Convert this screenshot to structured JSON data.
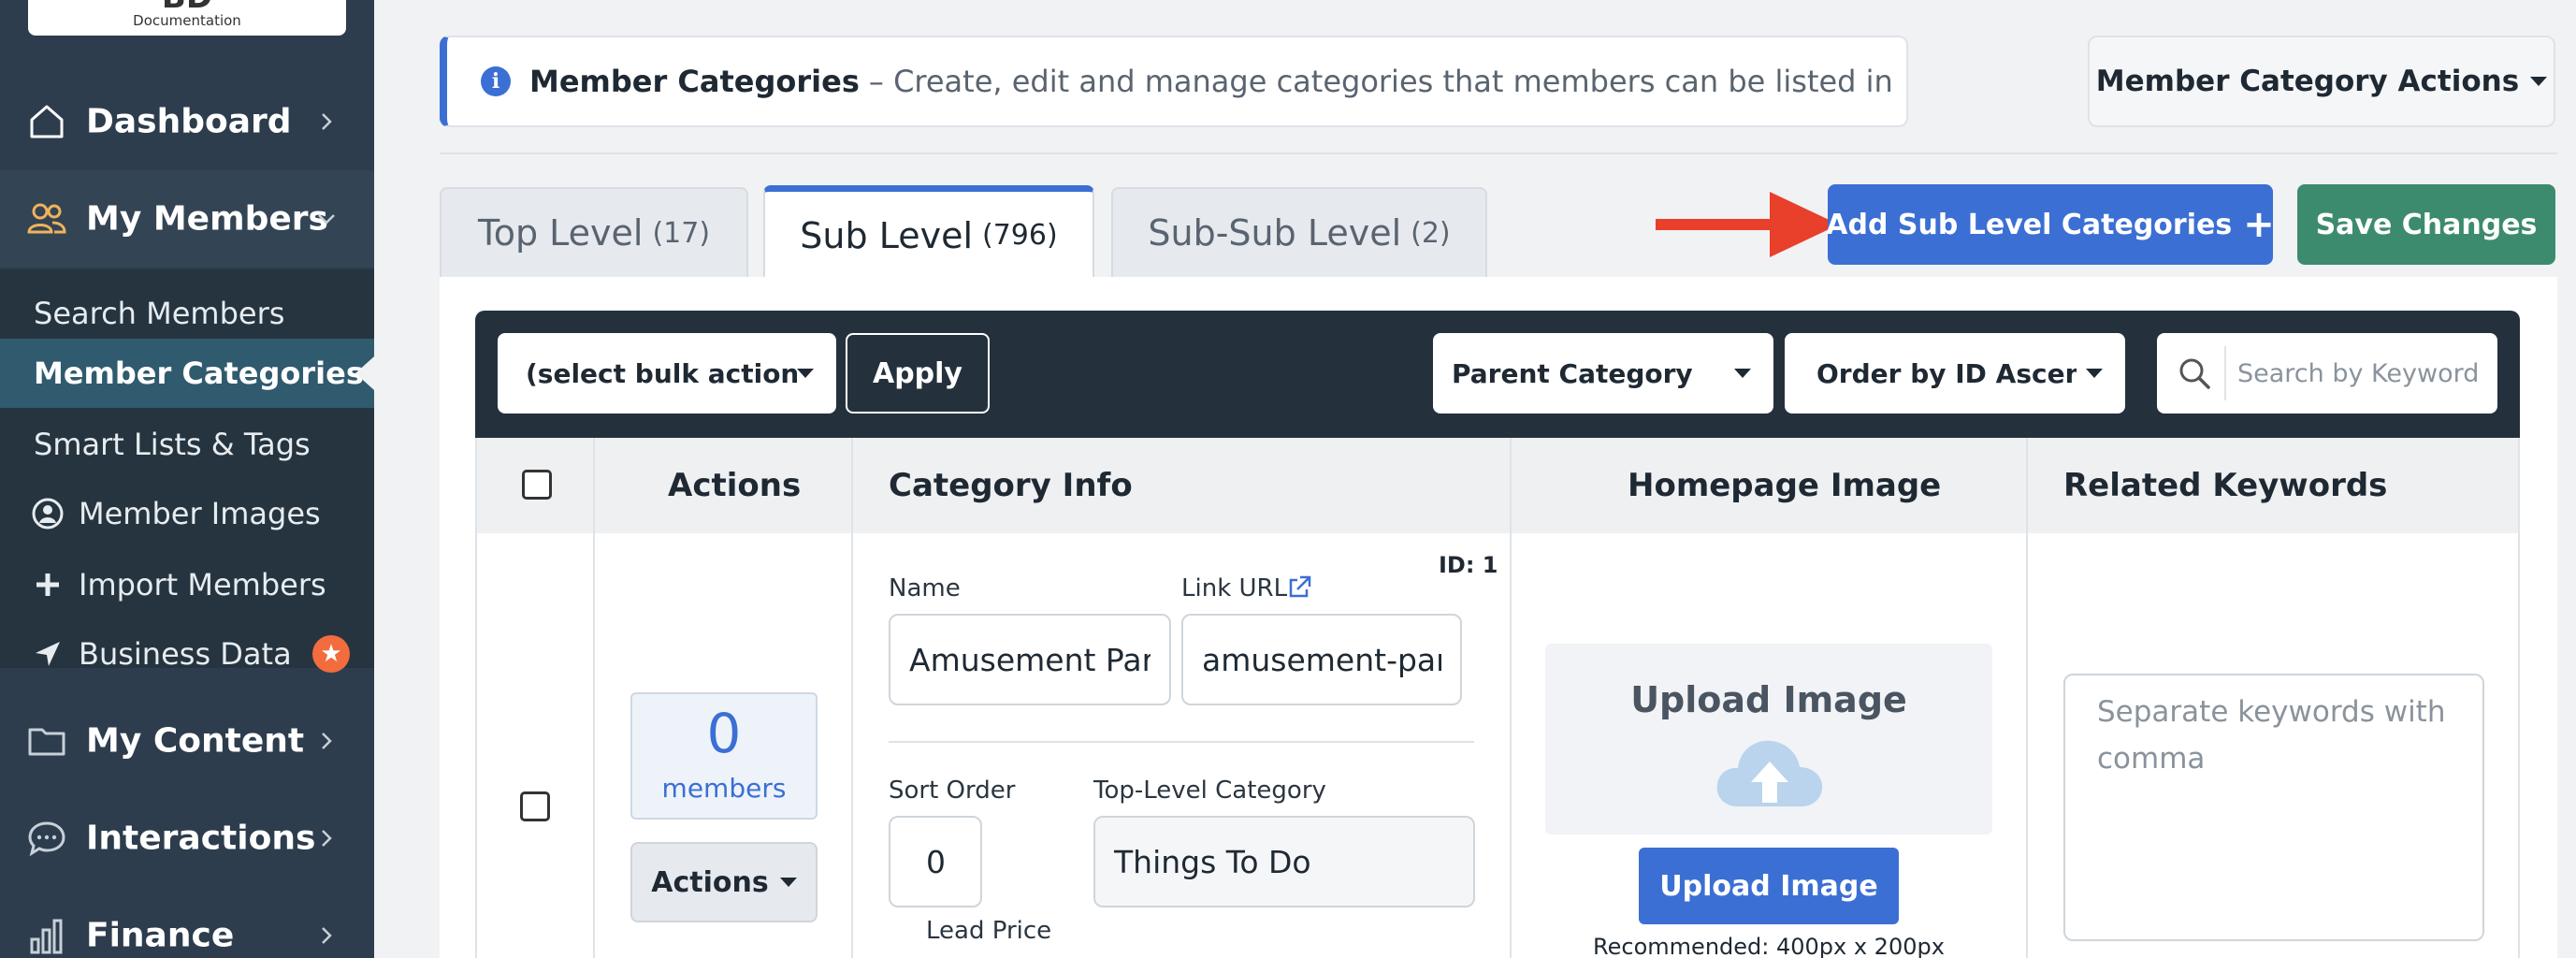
{
  "logo": {
    "mark": "BD",
    "sub": "Documentation"
  },
  "sidebar": {
    "nav": [
      {
        "label": "Dashboard",
        "icon": "home-icon"
      },
      {
        "label": "My Members",
        "icon": "users-icon"
      },
      {
        "label": "My Content",
        "icon": "folder-icon"
      },
      {
        "label": "Interactions",
        "icon": "chat-icon"
      },
      {
        "label": "Finance",
        "icon": "bar-chart-icon"
      }
    ],
    "sub_items": [
      {
        "label": "Search Members"
      },
      {
        "label": "Member Categories",
        "active": true
      },
      {
        "label": "Smart Lists & Tags"
      },
      {
        "label": "Member Images",
        "icon": "user-circle-icon"
      },
      {
        "label": "Import Members",
        "icon": "plus-icon"
      },
      {
        "label": "Business Data",
        "icon": "location-arrow-icon",
        "badge": "★"
      }
    ]
  },
  "header": {
    "title": "Member Categories",
    "description": "– Create, edit and manage categories that members can be listed in",
    "actions_label": "Member Category Actions"
  },
  "tabs": [
    {
      "label": "Top Level",
      "count": "(17)"
    },
    {
      "label": "Sub Level",
      "count": "(796)",
      "active": true
    },
    {
      "label": "Sub-Sub Level",
      "count": "(2)"
    }
  ],
  "buttons": {
    "add_label": "Add Sub Level Categories",
    "add_plus": "+",
    "save_label": "Save Changes"
  },
  "toolbar": {
    "bulk_action": "(select bulk action)",
    "apply_label": "Apply",
    "parent_category": "Parent Category",
    "order_by": "Order by ID Ascending",
    "search_placeholder": "Search by Keyword"
  },
  "table": {
    "headers": {
      "actions": "Actions",
      "category_info": "Category Info",
      "homepage_image": "Homepage Image",
      "related_keywords": "Related Keywords"
    },
    "row": {
      "id_label": "ID: 1",
      "name_label": "Name",
      "name_value": "Amusement Park",
      "link_label": "Link URL",
      "link_value": "amusement-park",
      "sort_label": "Sort Order",
      "sort_value": "0",
      "top_level_label": "Top-Level Category",
      "top_level_value": "Things To Do",
      "lead_price_label": "Lead Price",
      "members_count": "0",
      "members_word": "members",
      "actions_label": "Actions",
      "upload_title": "Upload Image",
      "upload_button": "Upload Image",
      "recommended": "Recommended: 400px x 200px",
      "keywords_placeholder": "Separate keywords with comma"
    }
  },
  "colors": {
    "primary": "#3b6fd4",
    "success": "#3d8b6e",
    "sidebar": "#2d3d4d",
    "toolbar": "#24313d",
    "arrow": "#e8402a",
    "badge": "#f26c3d"
  }
}
